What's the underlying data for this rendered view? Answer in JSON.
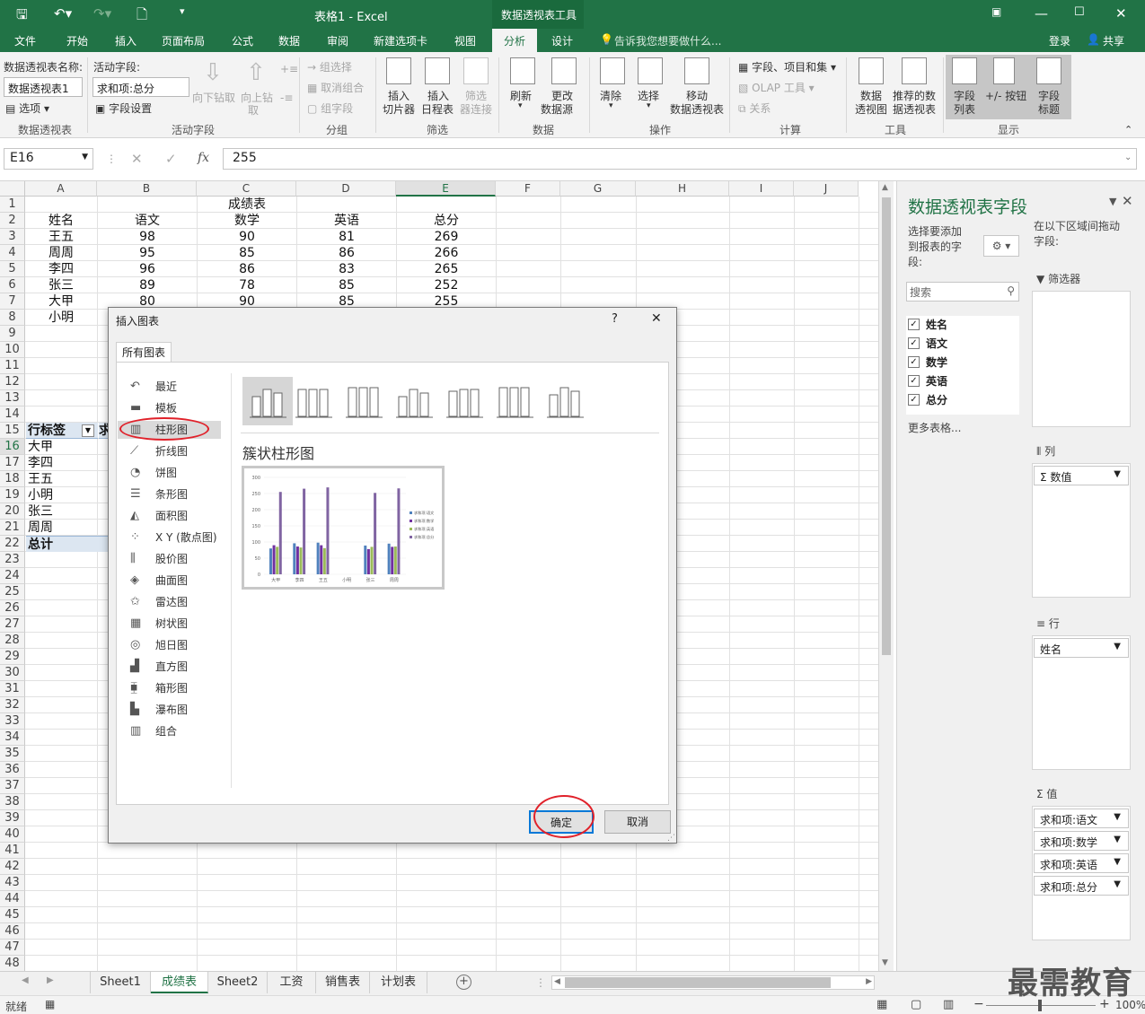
{
  "app": {
    "title": "表格1 - Excel",
    "context_group": "数据透视表工具",
    "tabs": [
      "文件",
      "开始",
      "插入",
      "页面布局",
      "公式",
      "数据",
      "审阅",
      "新建选项卡",
      "视图",
      "分析",
      "设计"
    ],
    "active_tab": "分析",
    "tell_me": "告诉我您想要做什么...",
    "login": "登录",
    "share": "共享"
  },
  "ribbon": {
    "pivot_name_label": "数据透视表名称:",
    "pivot_name_value": "数据透视表1",
    "options_label": "选项",
    "group_pivot": "数据透视表",
    "active_field_label": "活动字段:",
    "active_field_value": "求和项:总分",
    "field_settings": "字段设置",
    "drill_down": "向下钻取",
    "drill_up_1": "向上钻",
    "drill_up_2": "取",
    "group_active": "活动字段",
    "group_sel": "组选择",
    "ungroup": "取消组合",
    "group_field": "组字段",
    "group_group": "分组",
    "slicer_1": "插入",
    "slicer_2": "切片器",
    "timeline_1": "插入",
    "timeline_2": "日程表",
    "filter_conn_1": "筛选",
    "filter_conn_2": "器连接",
    "group_filter": "筛选",
    "refresh": "刷新",
    "change_src_1": "更改",
    "change_src_2": "数据源",
    "group_data": "数据",
    "clear": "清除",
    "select": "选择",
    "move_1": "移动",
    "move_2": "数据透视表",
    "group_actions": "操作",
    "fields_items": "字段、项目和集",
    "olap": "OLAP 工具",
    "relations": "关系",
    "group_calc": "计算",
    "pivotchart_1": "数据",
    "pivotchart_2": "透视图",
    "recommended_1": "推荐的数",
    "recommended_2": "据透视表",
    "group_tools": "工具",
    "field_list_1": "字段",
    "field_list_2": "列表",
    "buttons": "+/- 按钮",
    "headers_1": "字段",
    "headers_2": "标题",
    "group_show": "显示"
  },
  "formula_bar": {
    "name_box": "E16",
    "fx": "fx",
    "value": "255"
  },
  "grid": {
    "columns": [
      "A",
      "B",
      "C",
      "D",
      "E",
      "F",
      "G",
      "H",
      "I",
      "J"
    ],
    "row_numbers": [
      "1",
      "2",
      "3",
      "4",
      "5",
      "6",
      "7",
      "8",
      "9",
      "10",
      "11",
      "12",
      "13",
      "14",
      "15",
      "16",
      "17",
      "18",
      "19",
      "20",
      "21",
      "22",
      "23",
      "24",
      "25",
      "26",
      "27",
      "28",
      "29",
      "30",
      "31",
      "32",
      "33",
      "34",
      "35",
      "36",
      "37",
      "38",
      "39",
      "40",
      "41",
      "42",
      "43",
      "44",
      "45",
      "46",
      "47",
      "48"
    ],
    "table_title": "成绩表",
    "headers": [
      "姓名",
      "语文",
      "数学",
      "英语",
      "总分"
    ],
    "rows": [
      [
        "王五",
        "98",
        "90",
        "81",
        "269"
      ],
      [
        "周周",
        "95",
        "85",
        "86",
        "266"
      ],
      [
        "李四",
        "96",
        "86",
        "83",
        "265"
      ],
      [
        "张三",
        "89",
        "78",
        "85",
        "252"
      ],
      [
        "大甲",
        "80",
        "90",
        "85",
        "255"
      ],
      [
        "小明",
        "",
        "",
        "",
        ""
      ]
    ],
    "pivot_header": "行标签",
    "pivot_header_tail": "求",
    "pivot_rows": [
      "大甲",
      "李四",
      "王五",
      "小明",
      "张三",
      "周周"
    ],
    "pivot_total": "总计"
  },
  "panel": {
    "title": "数据透视表字段",
    "choose_fields": [
      "选择要添加",
      "到报表的字",
      "段:"
    ],
    "drag_between": [
      "在以下区域间拖动",
      "字段:"
    ],
    "search_placeholder": "搜索",
    "fields": [
      "姓名",
      "语文",
      "数学",
      "英语",
      "总分"
    ],
    "more_tables": "更多表格...",
    "filters_label": "筛选器",
    "columns_label": "列",
    "columns_item": "Σ 数值",
    "rows_label": "行",
    "rows_item": "姓名",
    "values_label": "值",
    "values_items": [
      "求和项:语文",
      "求和项:数学",
      "求和项:英语",
      "求和项:总分"
    ]
  },
  "dialog": {
    "title": "插入图表",
    "help": "?",
    "close": "✕",
    "tab": "所有图表",
    "chart_types": [
      "最近",
      "模板",
      "柱形图",
      "折线图",
      "饼图",
      "条形图",
      "面积图",
      "X Y (散点图)",
      "股价图",
      "曲面图",
      "雷达图",
      "树状图",
      "旭日图",
      "直方图",
      "箱形图",
      "瀑布图",
      "组合"
    ],
    "selected_type": "柱形图",
    "subtype_title": "簇状柱形图",
    "ok": "确定",
    "cancel": "取消"
  },
  "chart_data": {
    "type": "bar",
    "categories": [
      "大甲",
      "李四",
      "王五",
      "小明",
      "张三",
      "周周"
    ],
    "series": [
      {
        "name": "求和项:语文",
        "values": [
          80,
          96,
          98,
          0,
          89,
          95
        ],
        "color": "#4f81bd"
      },
      {
        "name": "求和项:数学",
        "values": [
          90,
          86,
          90,
          0,
          78,
          85
        ],
        "color": "#7030a0"
      },
      {
        "name": "求和项:英语",
        "values": [
          85,
          83,
          81,
          0,
          85,
          86
        ],
        "color": "#9bbb59"
      },
      {
        "name": "求和项:总分",
        "values": [
          255,
          265,
          269,
          0,
          252,
          266
        ],
        "color": "#8064a2"
      }
    ],
    "yticks": [
      "300",
      "250",
      "200",
      "150",
      "100",
      "50",
      "0"
    ],
    "ylim": [
      0,
      300
    ]
  },
  "sheets": [
    "Sheet1",
    "成绩表",
    "Sheet2",
    "工资",
    "销售表",
    "计划表"
  ],
  "active_sheet": "成绩表",
  "status": {
    "ready": "就绪",
    "zoom": "100%"
  },
  "watermark": "最需教育",
  "colors": {
    "excel_green": "#217346",
    "selection_blue": "#0078d7",
    "annotation_red": "#e0212a"
  }
}
